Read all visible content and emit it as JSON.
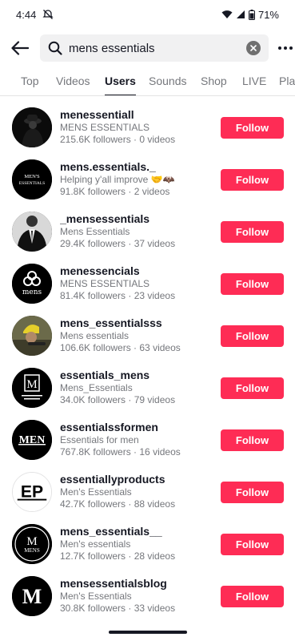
{
  "status_bar": {
    "time": "4:44",
    "battery": "71%",
    "icons": [
      "mute-icon",
      "wifi-icon",
      "signal-icon",
      "battery-icon"
    ]
  },
  "search": {
    "value": "mens essentials",
    "icons": [
      "back-arrow-icon",
      "search-icon",
      "clear-icon",
      "more-icon"
    ]
  },
  "tabs": [
    {
      "label": "Top",
      "active": false
    },
    {
      "label": "Videos",
      "active": false
    },
    {
      "label": "Users",
      "active": true
    },
    {
      "label": "Sounds",
      "active": false
    },
    {
      "label": "Shop",
      "active": false
    },
    {
      "label": "LIVE",
      "active": false
    },
    {
      "label": "Pla",
      "active": false
    }
  ],
  "follow_label": "Follow",
  "colors": {
    "accent": "#fe2c55",
    "text_primary": "#161823",
    "text_secondary": "#75777c",
    "search_bg": "#f1f1f2"
  },
  "users": [
    {
      "username": "menessentiall",
      "display_name": "MENS ESSENTIALS",
      "stats": "215.6K followers · 0 videos",
      "avatar_text": ""
    },
    {
      "username": "mens.essentials._",
      "display_name": "Helping y'all improve 🤝🦇",
      "stats": "91.8K followers · 2 videos",
      "avatar_text": "MEN'S ESSENTIALS"
    },
    {
      "username": "_mensessentials",
      "display_name": "Mens Essentials",
      "stats": "29.4K followers · 37 videos",
      "avatar_text": ""
    },
    {
      "username": "menessencials",
      "display_name": "MENS  ESSENTIALS",
      "stats": "81.4K followers · 23 videos",
      "avatar_text": "mens"
    },
    {
      "username": "mens_essentialsss",
      "display_name": "Mens essentials",
      "stats": "106.6K followers · 63 videos",
      "avatar_text": ""
    },
    {
      "username": "essentials_mens",
      "display_name": "Mens_Essentials",
      "stats": "34.0K followers · 79 videos",
      "avatar_text": "M"
    },
    {
      "username": "essentialssformen",
      "display_name": "Essentials for men",
      "stats": "767.8K followers · 16 videos",
      "avatar_text": "MEN"
    },
    {
      "username": "essentiallyproducts",
      "display_name": "Men's Essentials",
      "stats": "42.7K followers · 88 videos",
      "avatar_text": "EP"
    },
    {
      "username": "mens_essentials__",
      "display_name": "Men's essentials",
      "stats": "12.7K followers · 28 videos",
      "avatar_text": "MENS"
    },
    {
      "username": "mensessentialsblog",
      "display_name": "Men's Essentials",
      "stats": "30.8K followers · 33 videos",
      "avatar_text": "M"
    }
  ]
}
